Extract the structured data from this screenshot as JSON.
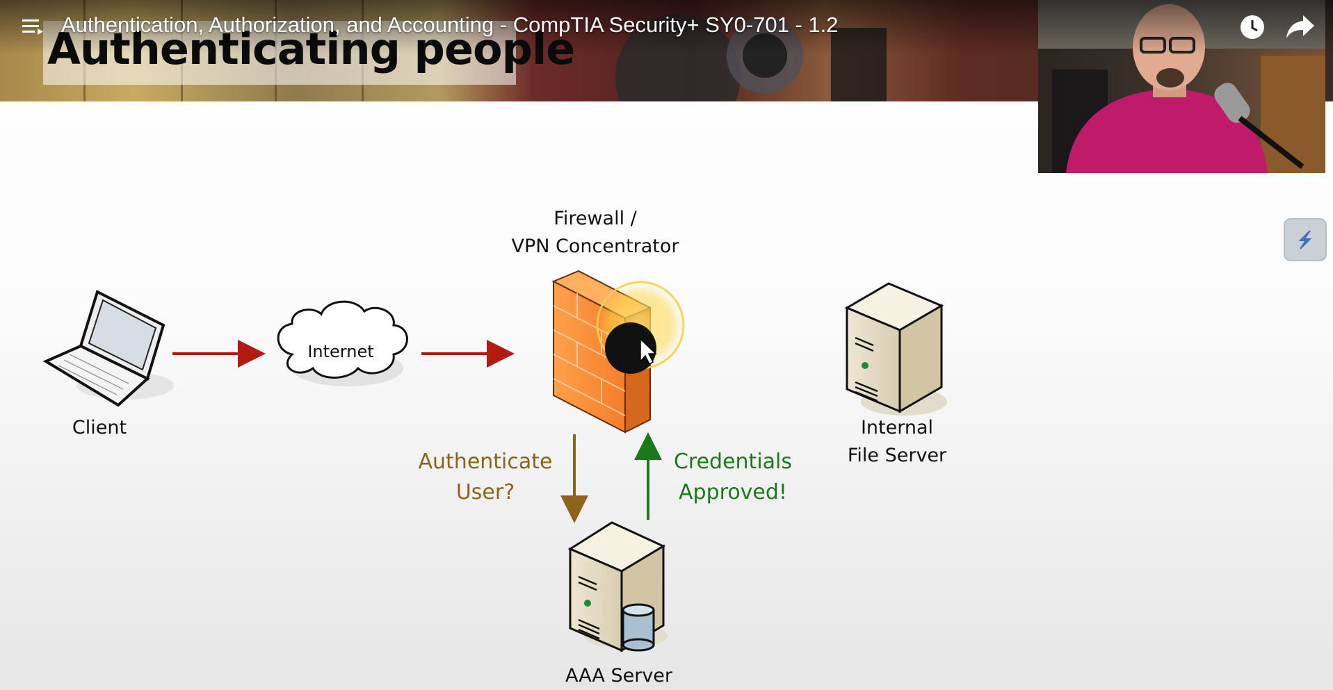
{
  "player": {
    "title": "Authentication, Authorization, and Accounting - CompTIA Security+ SY0-701 - 1.2",
    "menu_icon": "playlist-icon",
    "actions": [
      {
        "name": "watch-later",
        "icon": "clock-icon"
      },
      {
        "name": "share",
        "icon": "share-arrow-icon"
      }
    ]
  },
  "slide": {
    "title": "Authenticating people",
    "labels": {
      "client": "Client",
      "internet": "Internet",
      "firewall_line1": "Firewall /",
      "firewall_line2": "VPN Concentrator",
      "file_server_line1": "Internal",
      "file_server_line2": "File Server",
      "authenticate_line1": "Authenticate",
      "authenticate_line2": "User?",
      "credentials_line1": "Credentials",
      "credentials_line2": "Approved!",
      "aaa_server": "AAA Server"
    },
    "colors": {
      "request_arrow": "#b21a12",
      "authenticate_arrow": "#8b6418",
      "approved_arrow": "#1a7a1a",
      "firewall": "#f7923a"
    }
  },
  "extension": {
    "icon": "lightning-icon"
  }
}
